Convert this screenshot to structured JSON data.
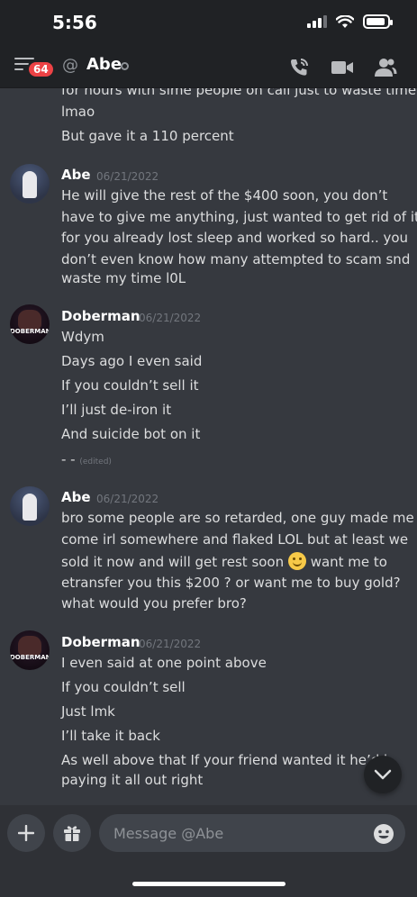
{
  "status_bar": {
    "time": "5:56"
  },
  "header": {
    "notification_count": "64",
    "at_symbol": "@",
    "title": "Abe"
  },
  "top_context": [
    "for hours with sime people on call just to waste time",
    "lmao",
    "But gave it a 110 percent"
  ],
  "messages": [
    {
      "author": "Abe",
      "timestamp": "06/21/2022",
      "avatar": "abe-avatar",
      "lines": [
        "He will give the rest of the $400 soon, you don’t",
        "have to give me anything, just wanted to get rid of it",
        "for you already lost sleep and worked so hard.. you",
        "don’t even know how many attempted to scam snd",
        "waste my time l0L"
      ]
    },
    {
      "author": "Doberman",
      "timestamp": "06/21/2022",
      "avatar": "doberman-avatar",
      "avatar_text": "DOBERMAN",
      "lines": [
        "Wdym",
        "Days ago I even said",
        "If you couldn’t sell it",
        "I’ll just de-iron it",
        "And suicide bot on it"
      ],
      "edited_line": "- -",
      "edited_label": "(edited)"
    },
    {
      "author": "Abe",
      "timestamp": "06/21/2022",
      "avatar": "abe-avatar",
      "lines": [
        "bro some people are so retarded, one guy made me",
        "come irl somewhere and flaked LOL but at least we",
        "sold it now and will get rest soon",
        "want me to",
        "etransfer you this $200 ? or want me to buy gold?",
        "what would you prefer bro?"
      ]
    },
    {
      "author": "Doberman",
      "timestamp": "06/21/2022",
      "avatar": "doberman-avatar",
      "avatar_text": "DOBERMAN",
      "lines": [
        "I even said at one point above",
        "If you couldn’t sell",
        "Just lmk",
        "I’ll take it back",
        "As well above that If your friend wanted it he’d b",
        "paying it all out right"
      ]
    }
  ],
  "composer": {
    "placeholder": "Message @Abe"
  },
  "colors": {
    "background": "#36393f",
    "header": "#202225",
    "badge": "#ed4245",
    "input": "#40444b"
  }
}
